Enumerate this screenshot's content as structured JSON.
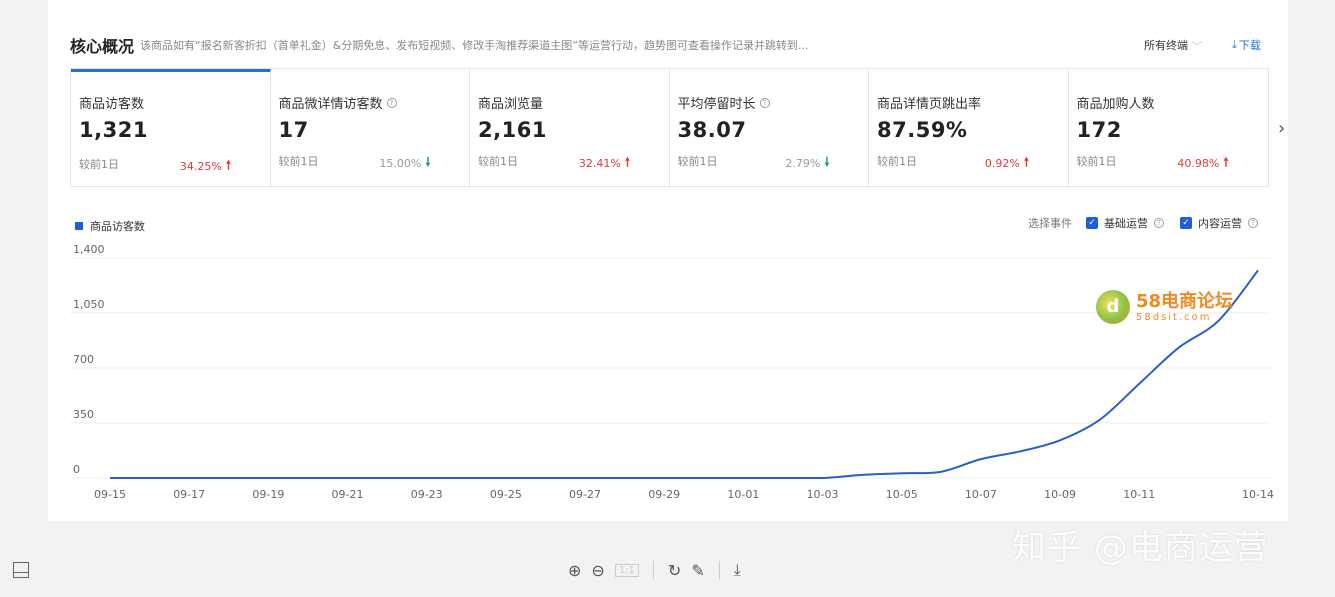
{
  "header": {
    "title": "核心概况",
    "description": "该商品如有“报名新客折扣（首单礼金）&分期免息、发布短视频、修改手淘推荐渠道主图”等运营行动，趋势图可查看操作记录并跳转到...",
    "terminal_select": "所有终端",
    "download_label": "下载"
  },
  "metrics": [
    {
      "label": "商品访客数",
      "value": "1,321",
      "compare": "较前1日",
      "change": "34.25%",
      "direction": "up",
      "help": false,
      "active": true
    },
    {
      "label": "商品微详情访客数",
      "value": "17",
      "compare": "较前1日",
      "change": "15.00%",
      "direction": "down",
      "help": true,
      "active": false
    },
    {
      "label": "商品浏览量",
      "value": "2,161",
      "compare": "较前1日",
      "change": "32.41%",
      "direction": "up",
      "help": false,
      "active": false
    },
    {
      "label": "平均停留时长",
      "value": "38.07",
      "compare": "较前1日",
      "change": "2.79%",
      "direction": "down",
      "help": true,
      "active": false
    },
    {
      "label": "商品详情页跳出率",
      "value": "87.59%",
      "compare": "较前1日",
      "change": "0.92%",
      "direction": "up",
      "help": false,
      "active": false
    },
    {
      "label": "商品加购人数",
      "value": "172",
      "compare": "较前1日",
      "change": "40.98%",
      "direction": "up",
      "help": false,
      "active": false
    }
  ],
  "chart_controls": {
    "events_label": "选择事件",
    "event1": "基础运营",
    "event2": "内容运营"
  },
  "chart_data": {
    "type": "line",
    "legend": "商品访客数",
    "ylim": [
      0,
      1400
    ],
    "yticks": [
      "0",
      "350",
      "700",
      "1,050",
      "1,400"
    ],
    "ytick_values": [
      0,
      350,
      700,
      1050,
      1400
    ],
    "xticks": [
      "09-15",
      "09-17",
      "09-19",
      "09-21",
      "09-23",
      "09-25",
      "09-27",
      "09-29",
      "10-01",
      "10-03",
      "10-05",
      "10-07",
      "10-09",
      "10-11",
      "10-14"
    ],
    "series": [
      {
        "name": "商品访客数",
        "color": "#2a5fc8",
        "x": [
          "09-15",
          "09-16",
          "09-17",
          "09-18",
          "09-19",
          "09-20",
          "09-21",
          "09-22",
          "09-23",
          "09-24",
          "09-25",
          "09-26",
          "09-27",
          "09-28",
          "09-29",
          "09-30",
          "10-01",
          "10-02",
          "10-03",
          "10-04",
          "10-05",
          "10-06",
          "10-07",
          "10-08",
          "10-09",
          "10-10",
          "10-11",
          "10-12",
          "10-13",
          "10-14"
        ],
        "values": [
          0,
          0,
          0,
          0,
          0,
          0,
          0,
          0,
          0,
          0,
          0,
          0,
          0,
          0,
          0,
          0,
          0,
          0,
          0,
          20,
          30,
          40,
          120,
          170,
          240,
          370,
          600,
          830,
          1000,
          1321
        ]
      }
    ]
  },
  "watermark": {
    "logo_char": "d",
    "main": "58电商论坛",
    "sub": "58dsit.com"
  },
  "overlay_text": "知乎 @电商运营"
}
